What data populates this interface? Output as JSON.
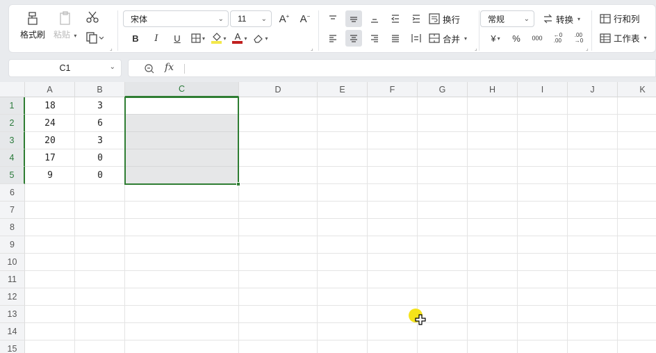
{
  "ribbon": {
    "format_painter_label": "格式刷",
    "paste_label": "粘贴",
    "font_name": "宋体",
    "font_size": "11",
    "bold": "B",
    "italic": "I",
    "underline": "U",
    "wrap_label": "换行",
    "merge_label": "合并",
    "number_format": "常规",
    "convert_label": "转换",
    "rows_cols_label": "行和列",
    "worksheet_label": "工作表",
    "currency_symbol": "¥",
    "percent_symbol": "%",
    "thousands_symbol": "000",
    "fill_color": "#f3e84a",
    "font_color": "#c0201f"
  },
  "formula_bar": {
    "cell_ref": "C1",
    "fx_label": "fx",
    "content": ""
  },
  "sheet": {
    "columns": [
      "A",
      "B",
      "C",
      "D",
      "E",
      "F",
      "G",
      "H",
      "I",
      "J",
      "K"
    ],
    "rows": [
      "1",
      "2",
      "3",
      "4",
      "5",
      "6",
      "7",
      "8",
      "9",
      "10",
      "11",
      "12",
      "13",
      "14",
      "15"
    ],
    "cells": {
      "A": [
        "18",
        "24",
        "20",
        "17",
        "9"
      ],
      "B": [
        "3",
        "6",
        "3",
        "0",
        "0"
      ]
    },
    "selected_column": "C",
    "selected_rows": [
      "1",
      "2",
      "3",
      "4",
      "5"
    ],
    "selection_color": "#2e7d32"
  }
}
